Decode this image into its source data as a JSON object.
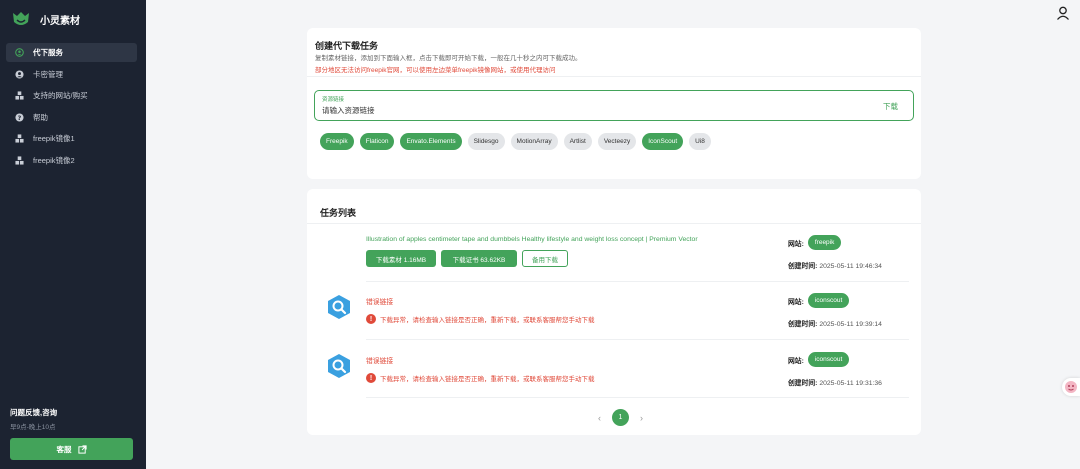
{
  "app": {
    "brand": "小灵素材"
  },
  "sidebar": {
    "items": [
      {
        "label": "代下服务",
        "icon": "circle-user-icon",
        "active": true
      },
      {
        "label": "卡密管理",
        "icon": "user-circle-icon",
        "active": false
      },
      {
        "label": "支持的网站/购买",
        "icon": "cubes-icon",
        "active": false
      },
      {
        "label": "帮助",
        "icon": "question-circle-icon",
        "active": false
      },
      {
        "label": "freepik镜像1",
        "icon": "cubes-icon",
        "active": false
      },
      {
        "label": "freepik镜像2",
        "icon": "cubes-icon",
        "active": false
      }
    ],
    "feedback_title": "问题反馈,咨询",
    "feedback_hours": "早9点-晚上10点",
    "service_button": "客服"
  },
  "create": {
    "title": "创建代下载任务",
    "desc": "复制素材链接，添加到下面输入框，点击下载即可开始下载，一般在几十秒之内可下载成功。",
    "warn": "部分地区无法访问freepik官网，可以使用左边菜单freepik镜像网站，或使用代理访问",
    "input_label": "资源链接",
    "input_placeholder": "请输入资源链接",
    "download_label": "下载",
    "sites": [
      {
        "label": "Freepik",
        "active": true
      },
      {
        "label": "Flaticon",
        "active": true
      },
      {
        "label": "Envato.Elements",
        "active": true
      },
      {
        "label": "Slidesgo",
        "active": false
      },
      {
        "label": "MotionArray",
        "active": false
      },
      {
        "label": "Artlist",
        "active": false
      },
      {
        "label": "Vecteezy",
        "active": false
      },
      {
        "label": "IconScout",
        "active": true
      },
      {
        "label": "Ui8",
        "active": false
      }
    ]
  },
  "tasks": {
    "title": "任务列表",
    "site_label": "网站:",
    "time_label": "创建时间:",
    "items": [
      {
        "name": "Illustration of apples centimeter tape and dumbbels Healthy lifestyle and weight loss concept | Premium Vector",
        "btn_material": "下载素材 1.16MB",
        "btn_license": "下载证书 63.62KB",
        "btn_backup": "备用下载",
        "site": "freepik",
        "time": "2025-05-11 19:46:34"
      },
      {
        "name": "错误链接",
        "error": "下载异常，请检查输入链接是否正确，重新下载，或联系客服帮您手动下载",
        "site": "iconscout",
        "time": "2025-05-11 19:39:14"
      },
      {
        "name": "错误链接",
        "error": "下载异常，请检查输入链接是否正确，重新下载，或联系客服帮您手动下载",
        "site": "iconscout",
        "time": "2025-05-11 19:31:36"
      }
    ],
    "pager": {
      "prev": "‹",
      "current": "1",
      "next": "›"
    }
  },
  "colors": {
    "accent": "#43a35a",
    "sidebar_bg": "#1c2331",
    "error": "#e04a3a"
  }
}
